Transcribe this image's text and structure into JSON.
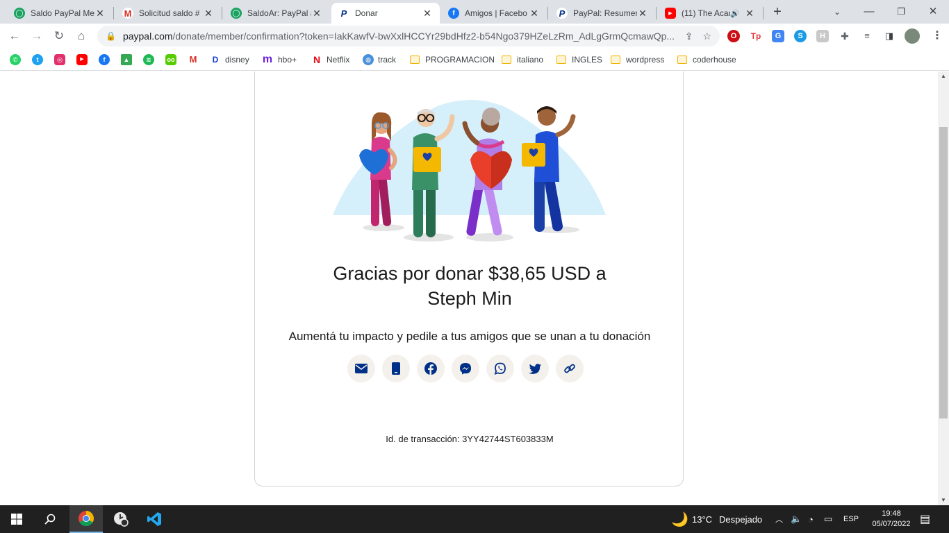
{
  "tabs": [
    {
      "title": "Saldo PayPal Mer",
      "icon": "green-circle-icon",
      "color": "#1aa260"
    },
    {
      "title": "Solicitud saldo #",
      "icon": "gmail-icon",
      "color": "#d93025"
    },
    {
      "title": "SaldoAr: PayPal a",
      "icon": "green-circle-icon",
      "color": "#1aa260"
    },
    {
      "title": "Donar",
      "icon": "paypal-icon",
      "color": "#003087"
    },
    {
      "title": "Amigos | Facebo",
      "icon": "facebook-icon",
      "color": "#1877f2"
    },
    {
      "title": "PayPal: Resumen",
      "icon": "paypal-icon",
      "color": "#003087"
    },
    {
      "title": "(11) The Acad",
      "icon": "youtube-icon",
      "color": "#ff0000"
    }
  ],
  "address": {
    "host": "paypal.com",
    "path": "/donate/member/confirmation?token=IakKawfV-bwXxlHCCYr29bdHfz2-b54Ngo379HZeLzRm_AdLgGrmQcmawQp..."
  },
  "bookmarks": [
    {
      "label": "",
      "icon": "whatsapp-icon",
      "color": "#25d366"
    },
    {
      "label": "",
      "icon": "twitter-icon",
      "color": "#1da1f2"
    },
    {
      "label": "",
      "icon": "instagram-icon",
      "color": "#e1306c"
    },
    {
      "label": "",
      "icon": "youtube-icon",
      "color": "#ff0000"
    },
    {
      "label": "",
      "icon": "facebook-icon",
      "color": "#1877f2"
    },
    {
      "label": "",
      "icon": "drive-icon",
      "color": "#34a853"
    },
    {
      "label": "",
      "icon": "spotify-icon",
      "color": "#1db954"
    },
    {
      "label": "",
      "icon": "duolingo-icon",
      "color": "#58cc02"
    },
    {
      "label": "",
      "icon": "gmail-icon",
      "color": "#d93025"
    },
    {
      "label": "disney",
      "icon": "disney-icon",
      "color": "#113ccf"
    },
    {
      "label": "hbo+",
      "icon": "hbo-icon",
      "color": "#6c1ee0"
    },
    {
      "label": "Netflix",
      "icon": "netflix-icon",
      "color": "#e50914"
    },
    {
      "label": "track",
      "icon": "globe-icon",
      "color": "#4a90d9"
    },
    {
      "label": "PROGRAMACION",
      "icon": "folder-icon",
      "color": "#f0b400"
    },
    {
      "label": "italiano",
      "icon": "folder-icon",
      "color": "#f0b400"
    },
    {
      "label": "INGLES",
      "icon": "folder-icon",
      "color": "#f0b400"
    },
    {
      "label": "wordpress",
      "icon": "folder-icon",
      "color": "#f0b400"
    },
    {
      "label": "coderhouse",
      "icon": "folder-icon",
      "color": "#f0b400"
    }
  ],
  "page": {
    "thanks_line1": "Gracias por donar $38,65 USD a",
    "thanks_line2": "Steph Min",
    "impact": "Aumentá tu impacto y pedile a tus amigos que se unan a tu donación",
    "share_icons": [
      "email-icon",
      "phone-icon",
      "facebook-icon",
      "messenger-icon",
      "whatsapp-icon",
      "twitter-icon",
      "link-icon"
    ],
    "transaction": "Id. de transacción: 3YY42744ST603833M",
    "accent": "#003087"
  },
  "taskbar": {
    "weather": "13°C",
    "weather_text": "Despejado",
    "lang": "ESP",
    "time": "19:48",
    "date": "05/07/2022"
  }
}
